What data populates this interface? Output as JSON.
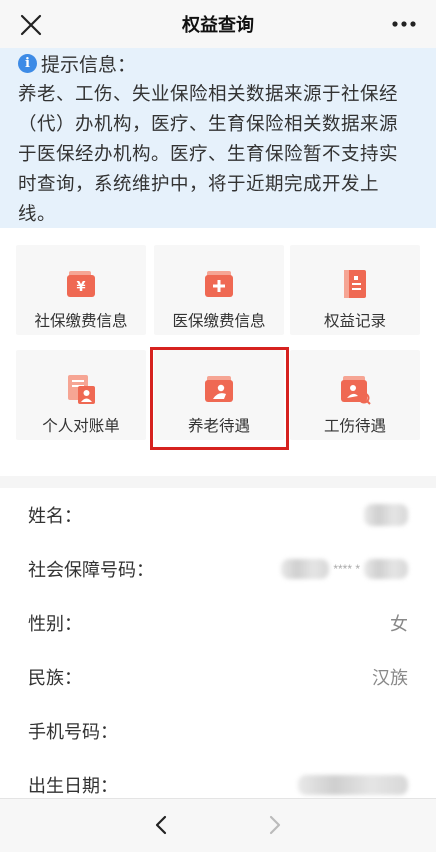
{
  "header": {
    "title": "权益查询",
    "close_icon": "close-icon",
    "more_icon": "more-icon"
  },
  "notice": {
    "title": "提示信息：",
    "icon": "info-icon",
    "lines": [
      "养老、工伤、失业保险相关数据来源于社保经",
      "（代）办机构，医疗、生育保险相关数据来源",
      "于医保经办机构。医疗、生育保险暂不支持实",
      "时查询，系统维护中，将于近期完成开发上",
      "线。"
    ]
  },
  "menu": {
    "items": [
      {
        "label": "社保缴费信息",
        "icon": "yuan-wallet-icon"
      },
      {
        "label": "医保缴费信息",
        "icon": "medical-wallet-icon"
      },
      {
        "label": "权益记录",
        "icon": "record-book-icon"
      },
      {
        "label": "个人对账单",
        "icon": "statement-icon"
      },
      {
        "label": "养老待遇",
        "icon": "pension-icon"
      },
      {
        "label": "工伤待遇",
        "icon": "injury-search-icon"
      }
    ],
    "highlighted": "养老待遇"
  },
  "profile": {
    "rows": [
      {
        "label": "姓名：",
        "value": ""
      },
      {
        "label": "社会保障号码：",
        "value": "**** *"
      },
      {
        "label": "性别：",
        "value": "女"
      },
      {
        "label": "民族：",
        "value": "汉族"
      },
      {
        "label": "手机号码：",
        "value": ""
      },
      {
        "label": "出生日期：",
        "value": ""
      }
    ]
  },
  "footer": {
    "back_icon": "chevron-left-icon",
    "forward_icon": "chevron-right-icon"
  },
  "colors": {
    "accent": "#f06a55",
    "highlight": "#d6221f",
    "notice_bg": "#e6f1fb",
    "info_blue": "#3d8be6"
  }
}
